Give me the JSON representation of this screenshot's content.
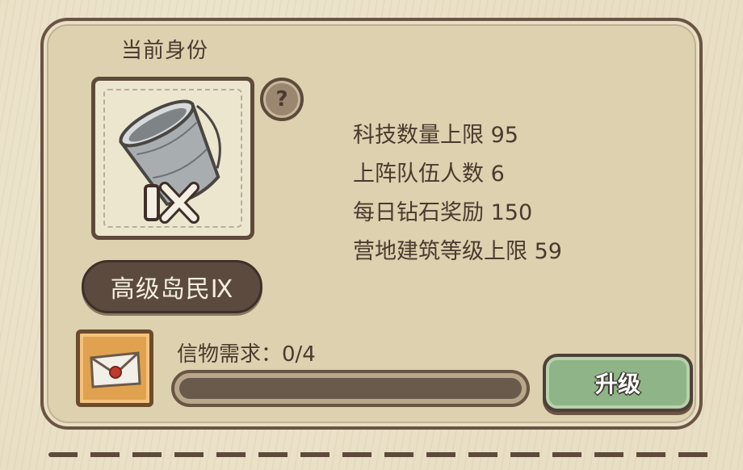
{
  "identity": {
    "label": "当前身份",
    "rank_name": "高级岛民Ⅸ",
    "rank_numeral": "Ⅸ",
    "portrait_icon": "tin-bucket-icon"
  },
  "help": {
    "symbol": "?",
    "icon": "question-icon"
  },
  "stats": [
    "科技数量上限 95",
    "上阵队伍人数 6",
    "每日钻石奖励 150",
    "营地建筑等级上限 59"
  ],
  "requirement": {
    "label": "信物需求：0/4",
    "current": 0,
    "required": 4,
    "icon": "sealed-letter-icon"
  },
  "upgrade_button": {
    "label": "升级"
  },
  "colors": {
    "panel": "#ddd1b0",
    "border": "#5e4a3b",
    "badge": "#5c4a3f",
    "button": "#8fb487",
    "token": "#e0a24f"
  }
}
